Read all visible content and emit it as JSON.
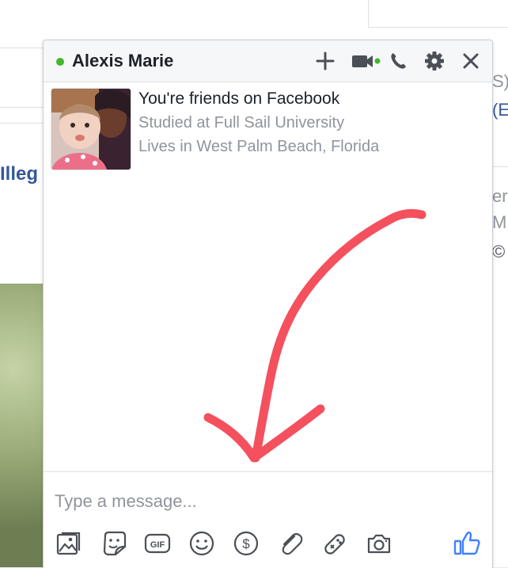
{
  "background": {
    "left_text": "Illeg",
    "right_texts": [
      "S)",
      "(E",
      "er",
      "M",
      "©"
    ]
  },
  "chat": {
    "contact_name": "Alexis Marie",
    "online_status_color": "#42b72a",
    "header_icons": [
      "plus-icon",
      "video-camera-icon",
      "phone-icon",
      "gear-icon",
      "close-icon"
    ],
    "friend_status": "You're friends on Facebook",
    "info_lines": [
      "Studied at Full Sail University",
      "Lives in West Palm Beach, Florida"
    ],
    "compose_placeholder": "Type a message...",
    "toolbar_icons": [
      "photo-icon",
      "sticker-icon",
      "gif-icon",
      "emoji-icon",
      "payment-icon",
      "attachment-icon",
      "game-icon",
      "camera-icon",
      "like-icon"
    ],
    "gif_label": "GIF",
    "annotation_color": "#f4505e",
    "accent_color": "#4080ff"
  }
}
